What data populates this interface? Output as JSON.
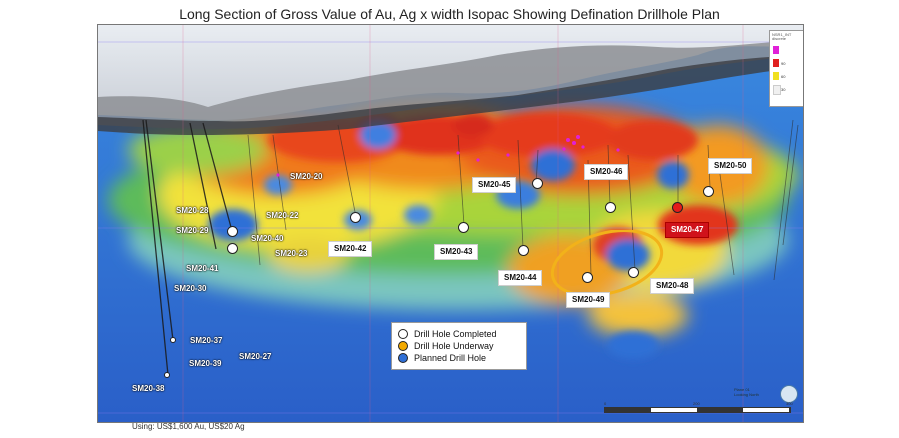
{
  "title": "Long Section of Gross Value of Au, Ag x width Isopac Showing Defination Drillhole Plan",
  "footnote": "Using: US$1,600 Au, US$20 Ag",
  "colors": {
    "completed": "#ffffff",
    "underway": "#f2a900",
    "planned": "#2f6fd6",
    "highlight_red": "#d0121b"
  },
  "legend": {
    "completed": "Drill Hole Completed",
    "underway": "Drill Hole Underway",
    "planned": "Planned Drill Hole"
  },
  "scale_legend": {
    "title_line1": "NSR1_INT",
    "title_line2": "discrete",
    "bins": [
      {
        "color": "#e020d8",
        "label": ""
      },
      {
        "color": "#e02020",
        "label": "90"
      },
      {
        "color": "#f0e020",
        "label": "60"
      },
      {
        "color": "#f0f0f0",
        "label": "30"
      }
    ]
  },
  "corner_text": {
    "line1": "Plane 01",
    "line2": "Looking North"
  },
  "scale_numbers": [
    "0",
    "",
    "200",
    "300"
  ],
  "drill_holes": [
    {
      "id": "SM20-20",
      "status": "completed",
      "has_marker": false
    },
    {
      "id": "SM20-22",
      "status": "completed",
      "has_marker": false
    },
    {
      "id": "SM20-23",
      "status": "completed",
      "has_marker": false
    },
    {
      "id": "SM20-27",
      "status": "completed",
      "has_marker": false
    },
    {
      "id": "SM20-28",
      "status": "completed",
      "has_marker": false
    },
    {
      "id": "SM20-29",
      "status": "completed",
      "has_marker": true
    },
    {
      "id": "SM20-30",
      "status": "completed",
      "has_marker": false
    },
    {
      "id": "SM20-37",
      "status": "completed",
      "has_marker": true
    },
    {
      "id": "SM20-38",
      "status": "completed",
      "has_marker": true
    },
    {
      "id": "SM20-39",
      "status": "completed",
      "has_marker": false
    },
    {
      "id": "SM20-40",
      "status": "completed",
      "has_marker": false
    },
    {
      "id": "SM20-41",
      "status": "completed",
      "has_marker": true
    },
    {
      "id": "SM20-42",
      "status": "completed",
      "has_marker": true
    },
    {
      "id": "SM20-43",
      "status": "completed",
      "has_marker": true
    },
    {
      "id": "SM20-44",
      "status": "completed",
      "has_marker": true
    },
    {
      "id": "SM20-45",
      "status": "completed",
      "has_marker": true
    },
    {
      "id": "SM20-46",
      "status": "completed",
      "has_marker": true
    },
    {
      "id": "SM20-47",
      "status": "underway_red",
      "has_marker": true
    },
    {
      "id": "SM20-48",
      "status": "completed",
      "has_marker": true
    },
    {
      "id": "SM20-49",
      "status": "completed",
      "has_marker": true
    },
    {
      "id": "SM20-50",
      "status": "completed",
      "has_marker": true
    }
  ]
}
